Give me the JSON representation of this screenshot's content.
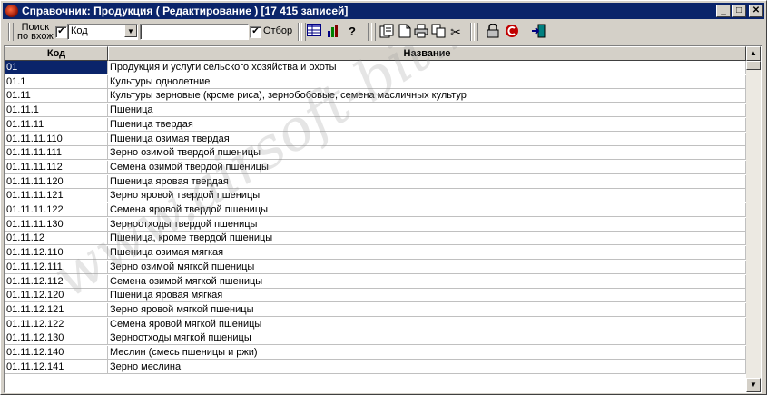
{
  "window": {
    "title": "Справочник: Продукция ( Редактирование ) [17 415 записей]",
    "minimize": "_",
    "maximize": "□",
    "close": "✕"
  },
  "toolbar": {
    "search_label_line1": "Поиск",
    "search_label_line2": "по вхож",
    "search_checked": true,
    "field_combo_value": "Код",
    "search_text": "",
    "filter_checked": true,
    "filter_label": "Отбор"
  },
  "table": {
    "columns": [
      "Код",
      "Название"
    ],
    "rows": [
      [
        "01",
        "Продукция и услуги сельского хозяйства и охоты"
      ],
      [
        "01.1",
        "Культуры однолетние"
      ],
      [
        "01.11",
        "Культуры зерновые (кроме риса), зернобобовые, семена масличных культур"
      ],
      [
        "01.11.1",
        "Пшеница"
      ],
      [
        "01.11.11",
        "Пшеница твердая"
      ],
      [
        "01.11.11.110",
        "Пшеница озимая твердая"
      ],
      [
        "01.11.11.111",
        "Зерно озимой твердой пшеницы"
      ],
      [
        "01.11.11.112",
        "Семена озимой твердой пшеницы"
      ],
      [
        "01.11.11.120",
        "Пшеница яровая твердая"
      ],
      [
        "01.11.11.121",
        "Зерно яровой твердой пшеницы"
      ],
      [
        "01.11.11.122",
        "Семена яровой твердой пшеницы"
      ],
      [
        "01.11.11.130",
        "Зерноотходы твердой пшеницы"
      ],
      [
        "01.11.12",
        "Пшеница, кроме твердой пшеницы"
      ],
      [
        "01.11.12.110",
        "Пшеница озимая мягкая"
      ],
      [
        "01.11.12.111",
        "Зерно озимой мягкой пшеницы"
      ],
      [
        "01.11.12.112",
        "Семена озимой мягкой пшеницы"
      ],
      [
        "01.11.12.120",
        "Пшеница яровая мягкая"
      ],
      [
        "01.11.12.121",
        "Зерно яровой мягкой пшеницы"
      ],
      [
        "01.11.12.122",
        "Семена яровой мягкой пшеницы"
      ],
      [
        "01.11.12.130",
        "Зерноотходы мягкой пшеницы"
      ],
      [
        "01.11.12.140",
        "Меслин (смесь пшеницы и ржи)"
      ],
      [
        "01.11.12.141",
        "Зерно меслина"
      ]
    ]
  },
  "watermark": "www.airsoft-bit.ru",
  "colors": {
    "titlebar": "#0a246a",
    "face": "#d4d0c8",
    "selection": "#0a246a"
  }
}
